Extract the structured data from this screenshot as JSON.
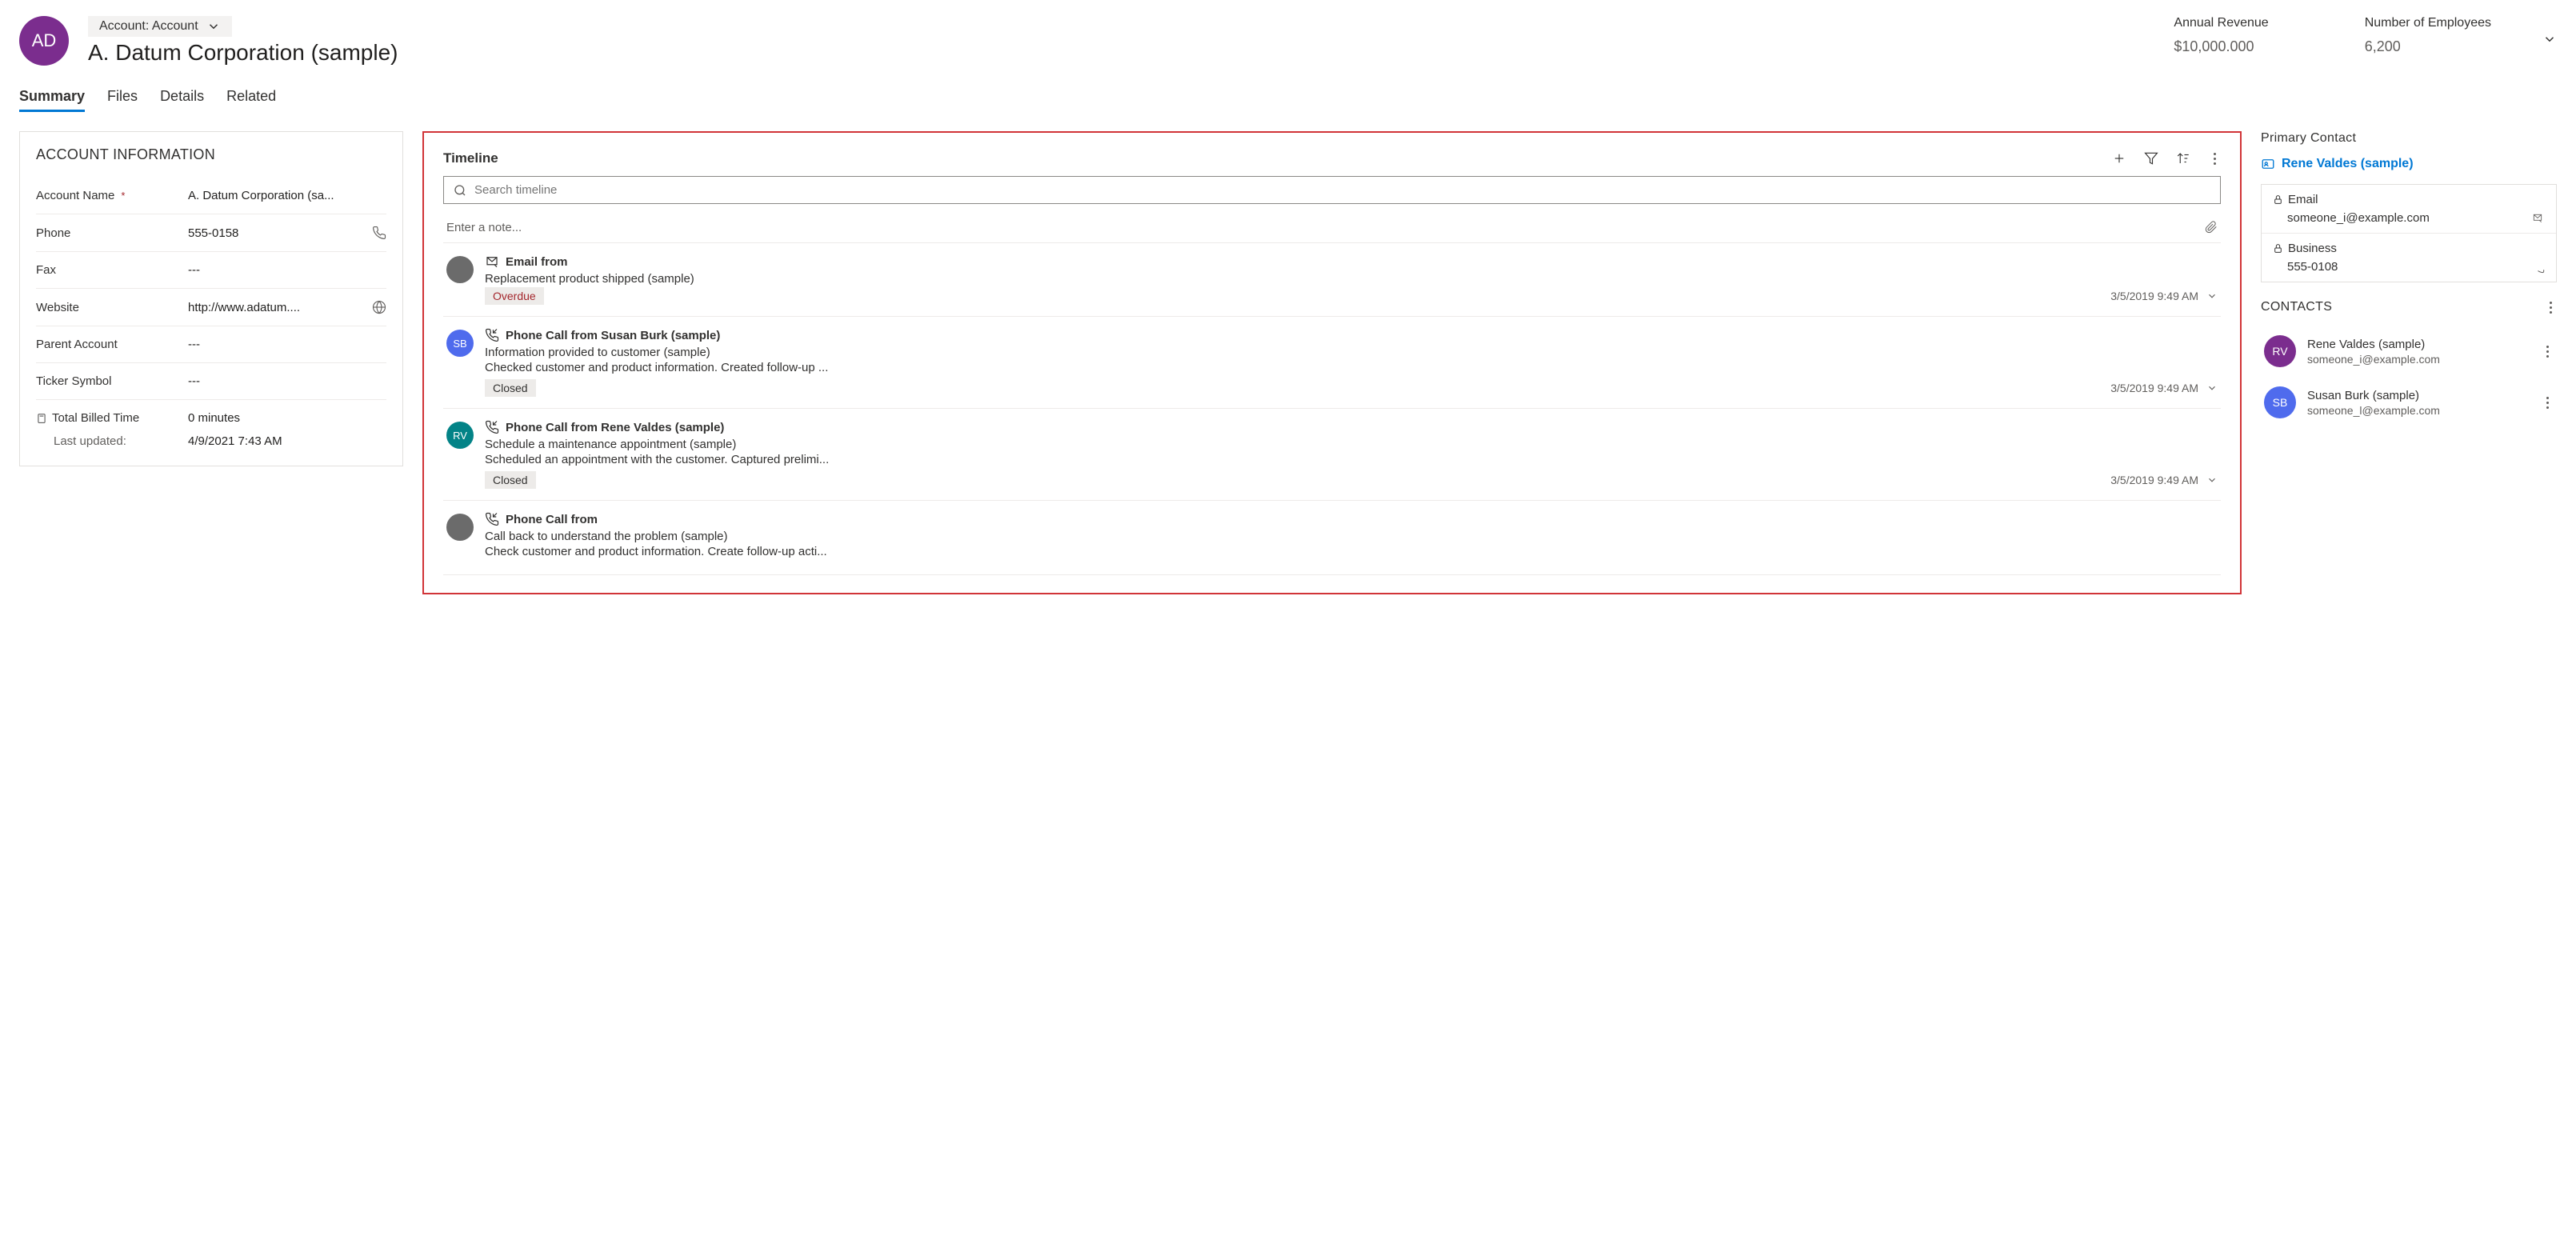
{
  "header": {
    "avatar_initials": "AD",
    "form_type": "Account: Account",
    "title": "A. Datum Corporation (sample)",
    "metrics": [
      {
        "label": "Annual Revenue",
        "value": "$10,000.000"
      },
      {
        "label": "Number of Employees",
        "value": "6,200"
      }
    ]
  },
  "tabs": [
    "Summary",
    "Files",
    "Details",
    "Related"
  ],
  "active_tab": "Summary",
  "account_info": {
    "section_title": "ACCOUNT INFORMATION",
    "fields": {
      "account_name": {
        "label": "Account Name",
        "value": "A. Datum Corporation (sa...",
        "required": true
      },
      "phone": {
        "label": "Phone",
        "value": "555-0158",
        "icon": "phone-icon"
      },
      "fax": {
        "label": "Fax",
        "value": "---"
      },
      "website": {
        "label": "Website",
        "value": "http://www.adatum....",
        "icon": "globe-icon"
      },
      "parent_account": {
        "label": "Parent Account",
        "value": "---"
      },
      "ticker": {
        "label": "Ticker Symbol",
        "value": "---"
      }
    },
    "total_billed": {
      "label": "Total Billed Time",
      "value": "0 minutes"
    },
    "last_updated": {
      "label": "Last updated:",
      "value": "4/9/2021 7:43 AM"
    }
  },
  "timeline": {
    "title": "Timeline",
    "search_placeholder": "Search timeline",
    "note_placeholder": "Enter a note...",
    "items": [
      {
        "avatar_initials": "",
        "avatar_color": "#6b6b6b",
        "type_icon": "email-icon",
        "title": "Email from",
        "subject": "Replacement product shipped (sample)",
        "description": "",
        "status": "Overdue",
        "status_kind": "overdue",
        "time": "3/5/2019 9:49 AM"
      },
      {
        "avatar_initials": "SB",
        "avatar_color": "#4f6bed",
        "type_icon": "phone-call-icon",
        "title": "Phone Call from Susan Burk (sample)",
        "subject": "Information provided to customer (sample)",
        "description": "Checked customer and product information. Created follow-up ...",
        "status": "Closed",
        "status_kind": "closed",
        "time": "3/5/2019 9:49 AM"
      },
      {
        "avatar_initials": "RV",
        "avatar_color": "#038387",
        "type_icon": "phone-call-icon",
        "title": "Phone Call from Rene Valdes (sample)",
        "subject": "Schedule a maintenance appointment (sample)",
        "description": "Scheduled an appointment with the customer. Captured prelimi...",
        "status": "Closed",
        "status_kind": "closed",
        "time": "3/5/2019 9:49 AM"
      },
      {
        "avatar_initials": "",
        "avatar_color": "#6b6b6b",
        "type_icon": "phone-call-icon",
        "title": "Phone Call from",
        "subject": "Call back to understand the problem (sample)",
        "description": "Check customer and product information. Create follow-up acti...",
        "status": "",
        "status_kind": "",
        "time": ""
      }
    ]
  },
  "primary_contact": {
    "section_title": "Primary Contact",
    "name": "Rene Valdes (sample)",
    "email": {
      "label": "Email",
      "value": "someone_i@example.com"
    },
    "business": {
      "label": "Business",
      "value": "555-0108"
    }
  },
  "contacts": {
    "section_title": "CONTACTS",
    "items": [
      {
        "initials": "RV",
        "color": "#7b2d8e",
        "name": "Rene Valdes (sample)",
        "email": "someone_i@example.com"
      },
      {
        "initials": "SB",
        "color": "#4f6bed",
        "name": "Susan Burk (sample)",
        "email": "someone_l@example.com"
      }
    ]
  }
}
